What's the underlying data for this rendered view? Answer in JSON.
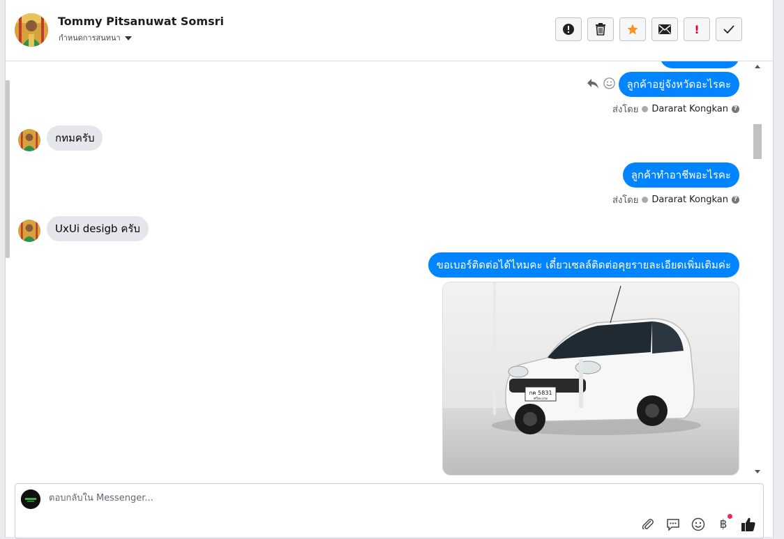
{
  "header": {
    "contact_name": "Tommy Pitsanuwat Somsri",
    "assign_label": "กำหนดการสนทนา"
  },
  "toolbar": {
    "alert": "!",
    "mark_unread_label": "!"
  },
  "messages": [
    {
      "direction": "out",
      "text": "ลูกค้าอยู่จังหวัดอะไรคะ"
    },
    {
      "direction": "in",
      "text": "กทมครับ"
    },
    {
      "direction": "out",
      "text": "ลูกค้าทำอาชีพอะไรคะ"
    },
    {
      "direction": "in",
      "text": "UxUi desigb ครับ"
    },
    {
      "direction": "out",
      "text": "ขอเบอร์ติดต่อได้ไหมคะ เดี๋ยวเซลล์ติดต่อคุยรายละเอียดเพิ่มเติมค่ะ"
    }
  ],
  "sent_by": {
    "prefix": "ส่งโดย",
    "agent": "Dararat Kongkan"
  },
  "photo": {
    "plate_text": "กค 5831",
    "plate_sub": "ศรีสะเกษ"
  },
  "composer": {
    "placeholder": "ตอบกลับใน Messenger...",
    "currency_icon_glyph": "฿"
  },
  "colors": {
    "outgoing_bubble": "#0084ff",
    "incoming_bubble": "#e4e6eb",
    "star": "#f7931e",
    "notification_dot": "#f02849"
  }
}
